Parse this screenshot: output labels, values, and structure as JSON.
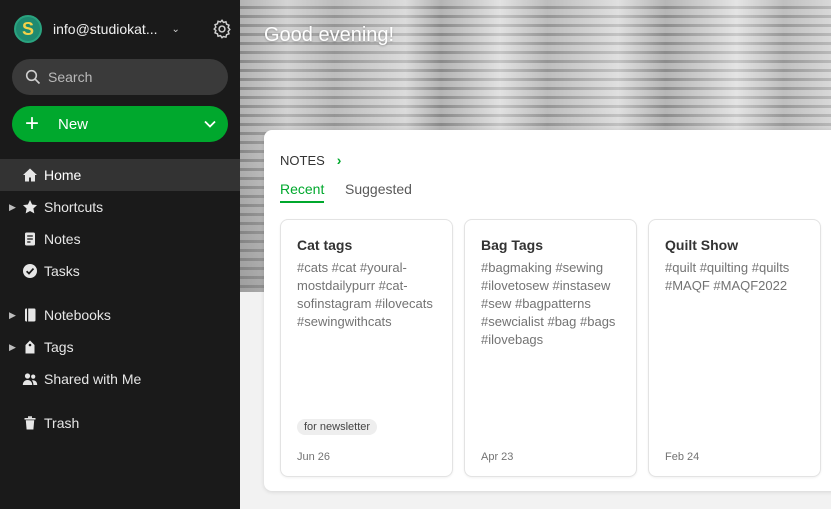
{
  "account": {
    "email": "info@studiokat...",
    "avatar_letter": "S"
  },
  "search": {
    "placeholder": "Search"
  },
  "new_button": {
    "label": "New"
  },
  "nav": {
    "home": "Home",
    "shortcuts": "Shortcuts",
    "notes": "Notes",
    "tasks": "Tasks",
    "notebooks": "Notebooks",
    "tags": "Tags",
    "shared": "Shared with Me",
    "trash": "Trash"
  },
  "main": {
    "greeting": "Good evening!",
    "notes_title": "NOTES",
    "tabs": {
      "recent": "Recent",
      "suggested": "Suggested"
    },
    "cards": [
      {
        "title": "Cat tags",
        "body": "#cats #cat #youral­mostdailypurr #cat­sofinstagram #ilove­cats #sewingwithcats",
        "tag": "for newsletter",
        "date": "Jun 26"
      },
      {
        "title": "Bag Tags",
        "body": "#bagmaking #sewing #ilovetosew #instasew #sew #bagpatterns #sewcialist #bag #bags #ilovebags",
        "tag": "",
        "date": "Apr 23"
      },
      {
        "title": "Quilt Show",
        "body": "#quilt #quilting #quilts #MAQF #MAQF2022",
        "tag": "",
        "date": "Feb 24"
      }
    ]
  },
  "colors": {
    "accent": "#00a82d",
    "sidebar": "#1a1a1a",
    "active_item": "#333333"
  }
}
